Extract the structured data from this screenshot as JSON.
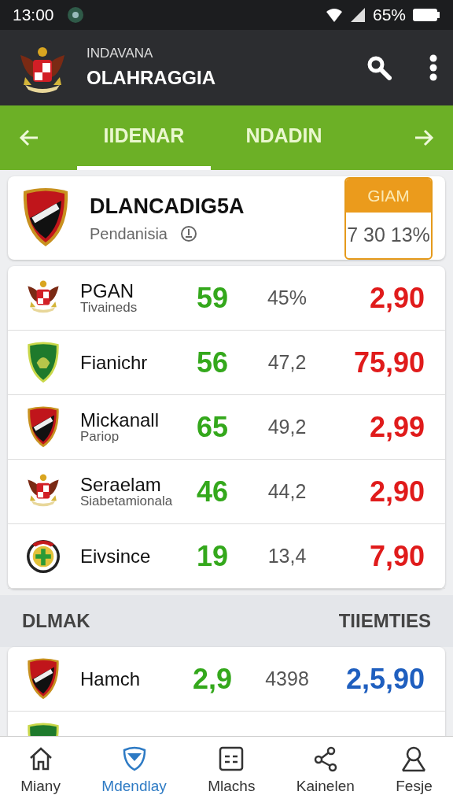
{
  "status_bar": {
    "time": "13:00",
    "battery": "65%"
  },
  "header": {
    "subtitle": "INDAVANA",
    "title": "OLAHRAGGIA"
  },
  "tabs": [
    {
      "label": "IIDENAR",
      "selected": true
    },
    {
      "label": "NDADIN",
      "selected": false
    }
  ],
  "featured": {
    "title": "DLANCADIG5A",
    "subtitle": "Pendanisia",
    "box_title": "GIAM",
    "box_value": "7 30 13%"
  },
  "teams": [
    {
      "kind": "emblem",
      "name": "PGAN",
      "sub": "Tivaineds",
      "score": "59",
      "pct": "45%",
      "odds": "2,90",
      "color": "#e01b1b"
    },
    {
      "kind": "green-shield",
      "name": "Fianichr",
      "score": "56",
      "pct": "47,2",
      "odds": "75,90",
      "color": "#e01b1b"
    },
    {
      "kind": "shield",
      "name": "Mickanall",
      "sub": "Pariop",
      "score": "65",
      "pct": "49,2",
      "odds": "2,99",
      "color": "#e01b1b"
    },
    {
      "kind": "emblem",
      "name": "Seraelam",
      "sub": "Siabetamionala",
      "score": "46",
      "pct": "44,2",
      "odds": "2,90",
      "color": "#e01b1b"
    },
    {
      "kind": "round",
      "name": "Eivsince",
      "score": "19",
      "pct": "13,4",
      "odds": "7,90",
      "color": "#e01b1b"
    }
  ],
  "section": {
    "left": "DLMAK",
    "right": "TIIEMTIES"
  },
  "teams2": [
    {
      "kind": "shield",
      "name": "Hamch",
      "score": "2,9",
      "pct": "4398",
      "odds": "2,5,90",
      "color": "#1f5fbf"
    },
    {
      "kind": "green-shield"
    }
  ],
  "nav": [
    {
      "kind": "home",
      "label": "Miany",
      "selected": false
    },
    {
      "kind": "shield",
      "label": "Mdendlay",
      "selected": true
    },
    {
      "kind": "list",
      "label": "Mlachs",
      "selected": false
    },
    {
      "kind": "share",
      "label": "Kainelen",
      "selected": false
    },
    {
      "kind": "person",
      "label": "Fesje",
      "selected": false
    }
  ]
}
